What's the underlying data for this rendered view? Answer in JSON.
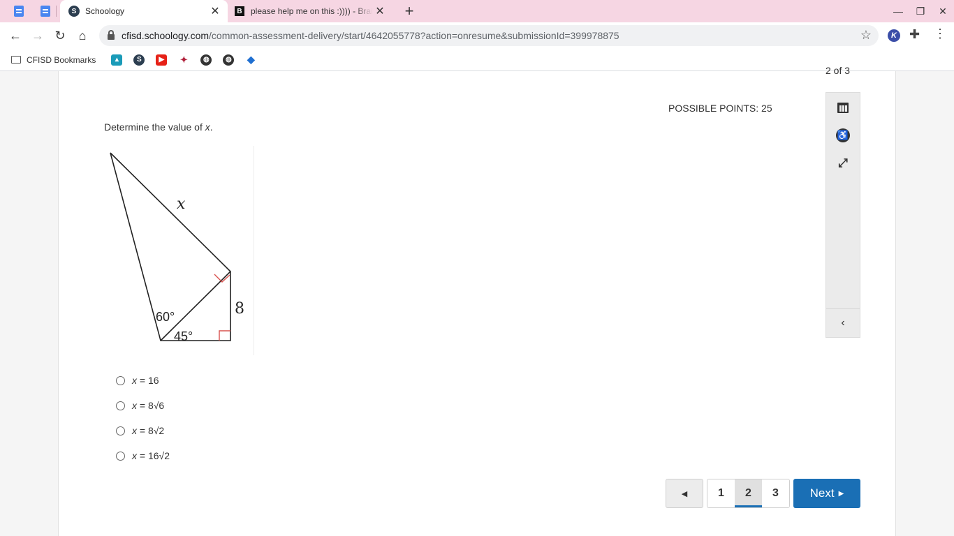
{
  "browser": {
    "tabs": [
      {
        "title": "Schoology",
        "favicon": "S",
        "active": true
      },
      {
        "title": "please help me on this :)))) - Brainly",
        "favicon": "B",
        "active": false
      }
    ],
    "url_host": "cfisd.schoology.com",
    "url_path": "/common-assessment-delivery/start/4642055778?action=onresume&submissionId=399978875",
    "extension_letter": "K",
    "bookmarks_folder": "CFISD Bookmarks"
  },
  "assessment": {
    "counter": "2 of 3",
    "possible_points": "POSSIBLE POINTS: 25",
    "question_prefix": "Determine the value of ",
    "question_var": "x",
    "question_suffix": ".",
    "figure": {
      "hyp_label": "x",
      "side_label": "8",
      "angle_top": "60°",
      "angle_bottom": "45°"
    },
    "choices": [
      {
        "var": "x",
        "rest": " = 16"
      },
      {
        "var": "x",
        "rest": " = 8√6"
      },
      {
        "var": "x",
        "rest": " = 8√2"
      },
      {
        "var": "x",
        "rest": " = 16√2"
      }
    ]
  },
  "pager": {
    "prev": "◀",
    "pages": [
      "1",
      "2",
      "3"
    ],
    "current": "2",
    "next_label": "Next",
    "next_arrow": "▶"
  },
  "icons": {
    "side_tools": [
      "calculator-icon",
      "accessibility-icon",
      "fullscreen-icon",
      "collapse-chevron-icon"
    ]
  }
}
